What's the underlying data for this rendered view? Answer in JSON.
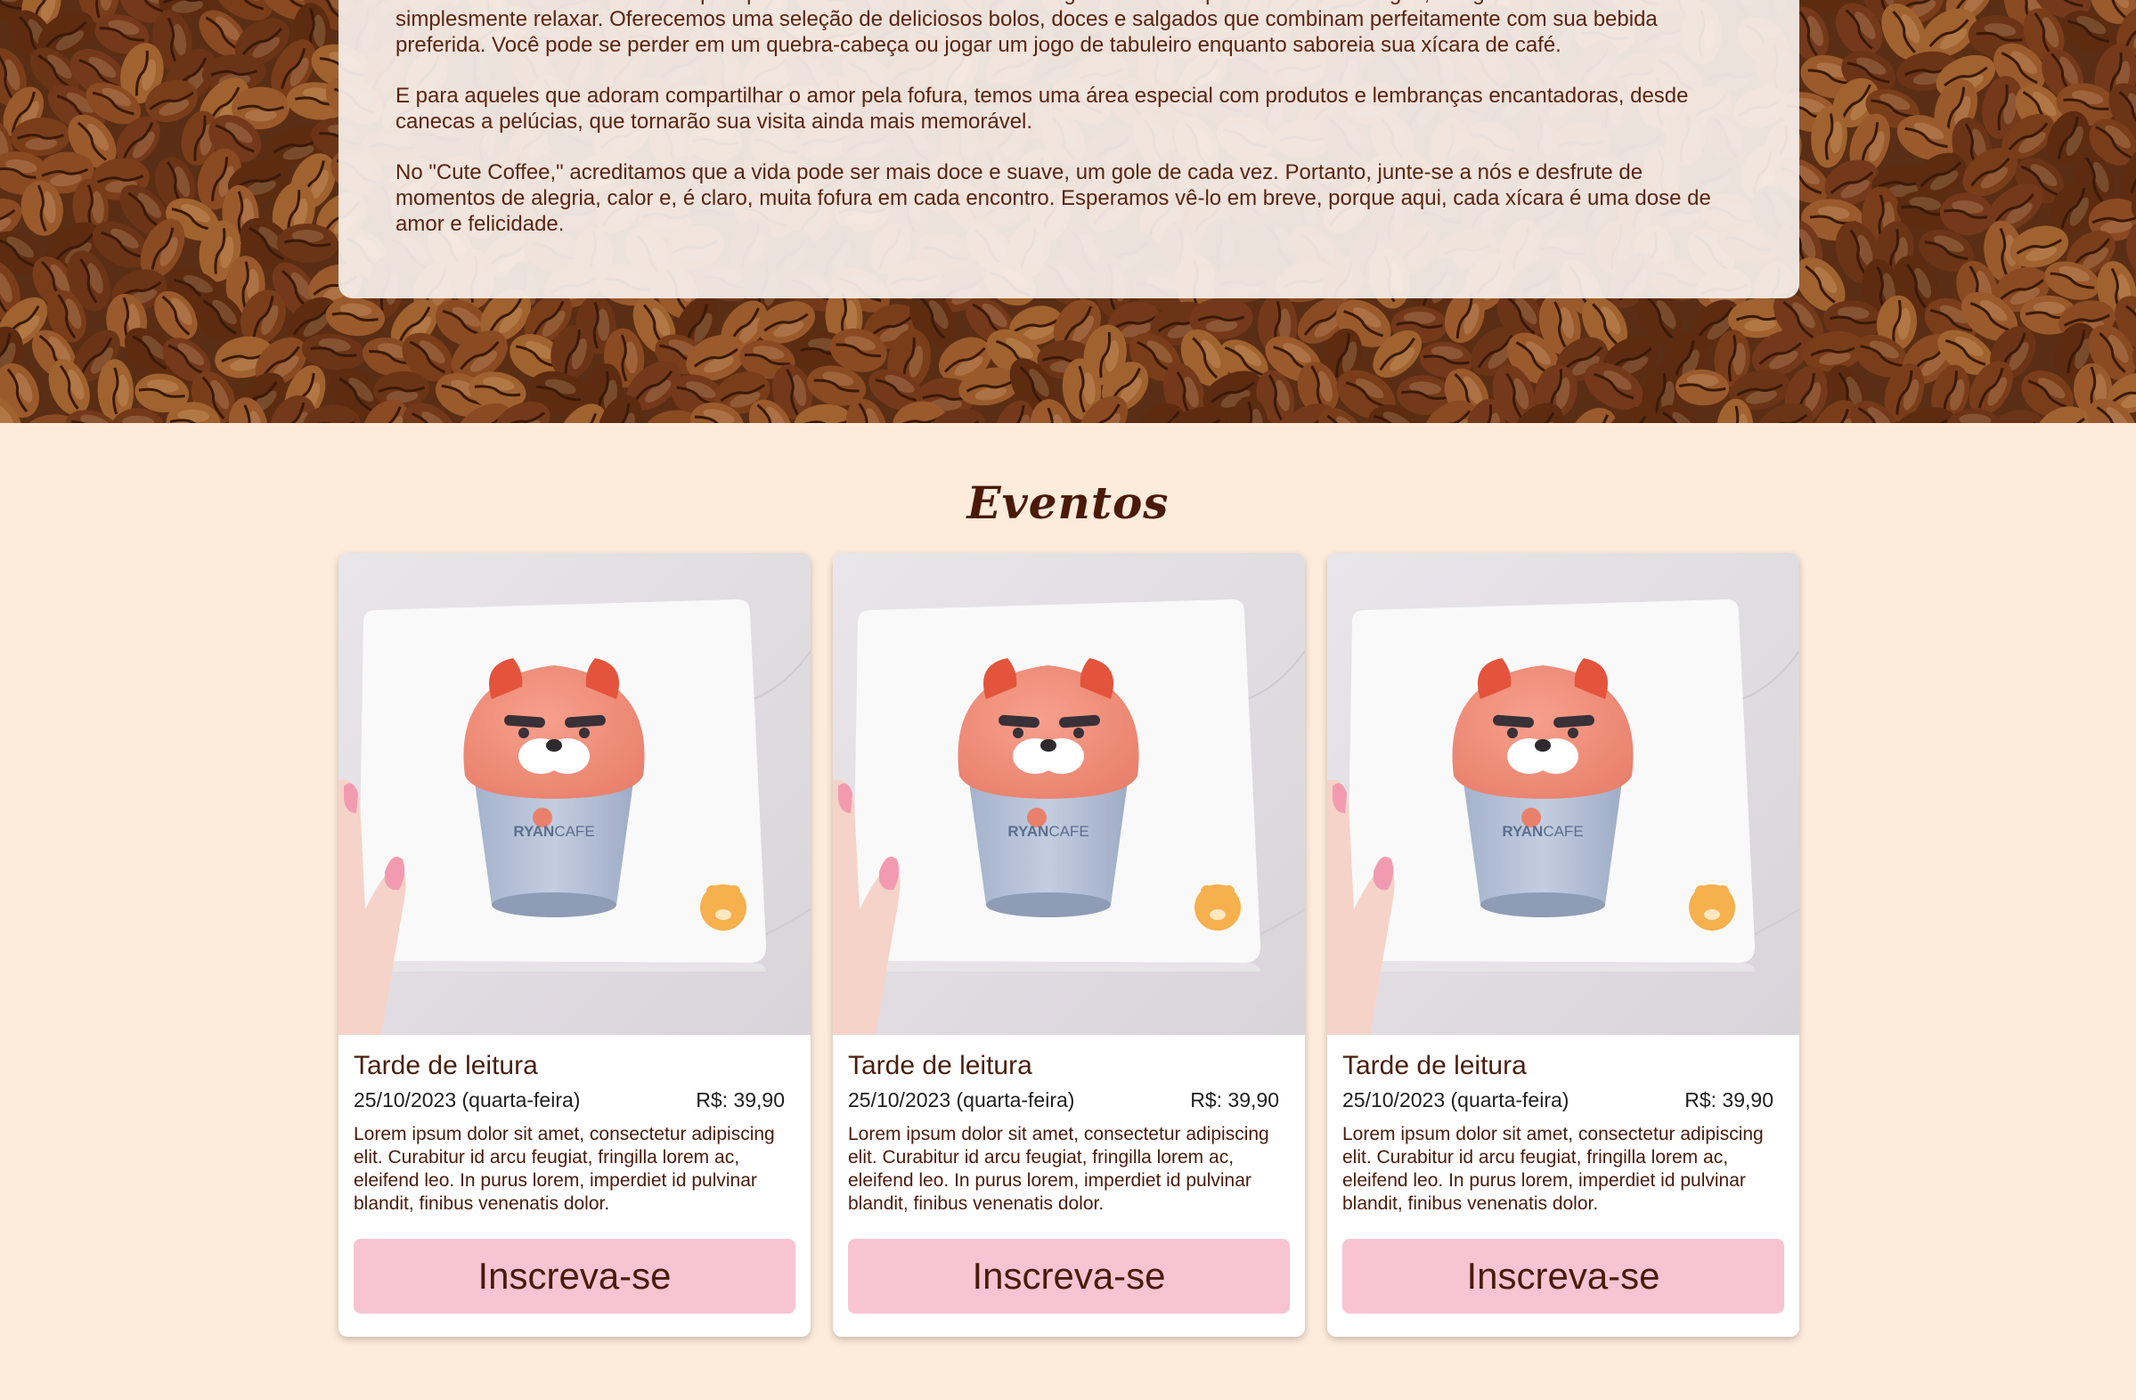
{
  "about": {
    "paragraphs": [
      "Mas o \"Cute Coffee\" é mais do que apenas uma casa de café. É um lugar onde você pode encontrar amigos, mergulhar em um bom livro ou simplesmente relaxar. Oferecemos uma seleção de deliciosos bolos, doces e salgados que combinam perfeitamente com sua bebida preferida. Você pode se perder em um quebra-cabeça ou jogar um jogo de tabuleiro enquanto saboreia sua xícara de café.",
      "E para aqueles que adoram compartilhar o amor pela fofura, temos uma área especial com produtos e lembranças encantadoras, desde canecas a pelúcias, que tornarão sua visita ainda mais memorável.",
      "No \"Cute Coffee,\" acreditamos que a vida pode ser mais doce e suave, um gole de cada vez. Portanto, junte-se a nós e desfrute de momentos de alegria, calor e, é claro, muita fofura em cada encontro. Esperamos vê-lo em breve, porque aqui, cada xícara é uma dose de amor e felicidade."
    ]
  },
  "events": {
    "title": "Eventos",
    "cards": [
      {
        "title": "Tarde de leitura",
        "date": "25/10/2023 (quarta-feira)",
        "price": "R$: 39,90",
        "description": "Lorem ipsum dolor sit amet, consectetur adipiscing elit. Curabitur id arcu feugiat, fringilla lorem ac, eleifend leo. In purus lorem, imperdiet id pulvinar blandit, finibus venenatis dolor.",
        "button_label": "Inscreva-se",
        "image_text": "RYANCAFE"
      },
      {
        "title": "Tarde de leitura",
        "date": "25/10/2023 (quarta-feira)",
        "price": "R$: 39,90",
        "description": "Lorem ipsum dolor sit amet, consectetur adipiscing elit. Curabitur id arcu feugiat, fringilla lorem ac, eleifend leo. In purus lorem, imperdiet id pulvinar blandit, finibus venenatis dolor.",
        "button_label": "Inscreva-se",
        "image_text": "RYANCAFE"
      },
      {
        "title": "Tarde de leitura",
        "date": "25/10/2023 (quarta-feira)",
        "price": "R$: 39,90",
        "description": "Lorem ipsum dolor sit amet, consectetur adipiscing elit. Curabitur id arcu feugiat, fringilla lorem ac, eleifend leo. In purus lorem, imperdiet id pulvinar blandit, finibus venenatis dolor.",
        "button_label": "Inscreva-se",
        "image_text": "RYANCAFE"
      }
    ]
  },
  "colors": {
    "page_background": "#fdebdb",
    "button": "#f8c4d3",
    "heading": "#4a1a06"
  }
}
